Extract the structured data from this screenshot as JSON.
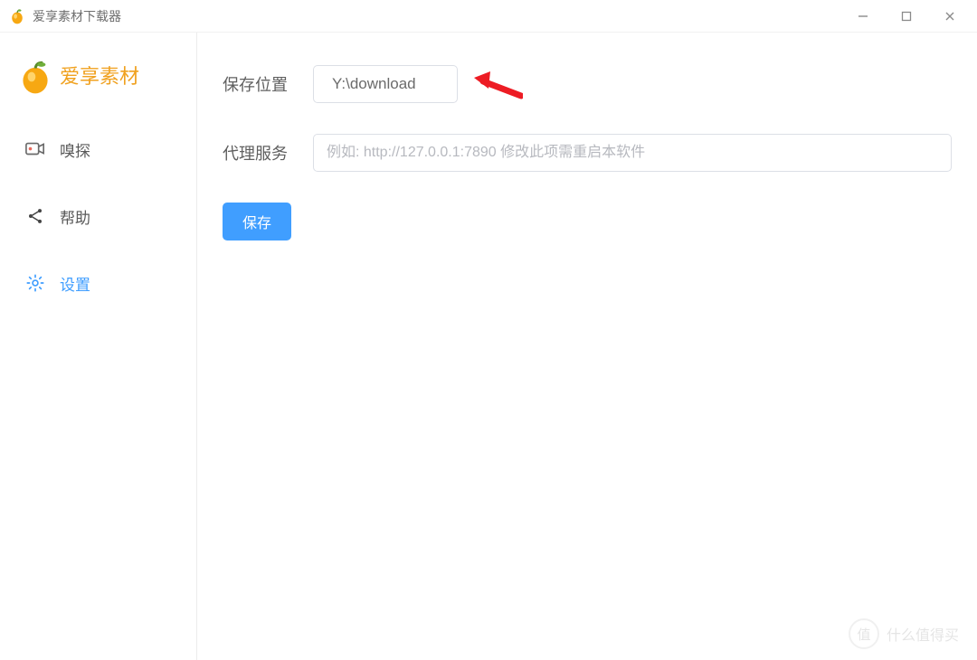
{
  "window": {
    "title": "爱享素材下载器"
  },
  "brand": {
    "text": "爱享素材"
  },
  "sidebar": {
    "items": [
      {
        "icon": "camera-icon",
        "label": "嗅探",
        "active": false
      },
      {
        "icon": "share-icon",
        "label": "帮助",
        "active": false
      },
      {
        "icon": "gear-icon",
        "label": "设置",
        "active": true
      }
    ]
  },
  "settings": {
    "save_path_label": "保存位置",
    "save_path_value": "Y:\\download",
    "proxy_label": "代理服务",
    "proxy_value": "",
    "proxy_placeholder": "例如: http://127.0.0.1:7890 修改此项需重启本软件",
    "save_button": "保存"
  },
  "watermark": {
    "badge": "值",
    "text": "什么值得买"
  },
  "colors": {
    "accent": "#409eff",
    "brand": "#f0a11f",
    "arrow": "#ed1c24"
  }
}
